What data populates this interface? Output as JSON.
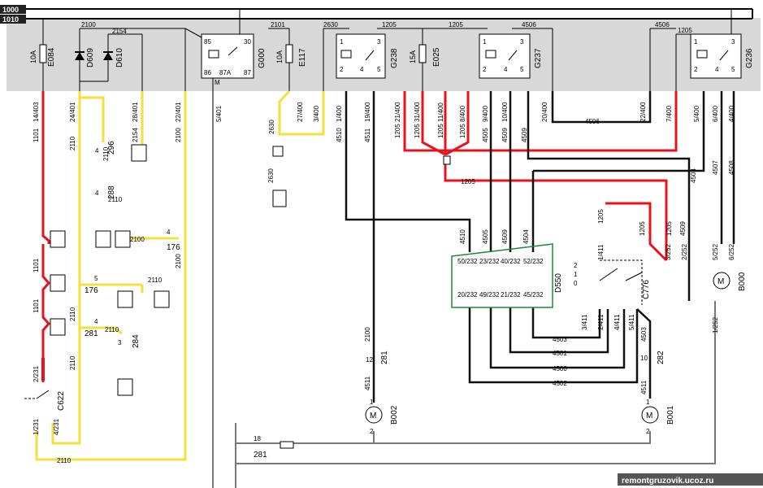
{
  "buses": {
    "top": "1000",
    "second": "1010"
  },
  "fuses": [
    {
      "amp": "10A",
      "id": "E084"
    },
    {
      "amp": "10A",
      "id": "E117"
    },
    {
      "amp": "15A",
      "id": "E025"
    }
  ],
  "diodes": [
    "D609",
    "D610"
  ],
  "relays": [
    {
      "id": "G000",
      "pins": [
        "85",
        "30",
        "86",
        "87A",
        "87"
      ]
    },
    {
      "id": "G238",
      "pins": [
        "1",
        "3",
        "2",
        "4",
        "5"
      ]
    },
    {
      "id": "G237",
      "pins": [
        "1",
        "3",
        "2",
        "4",
        "5"
      ]
    },
    {
      "id": "G236",
      "pins": [
        "1",
        "3",
        "2",
        "4",
        "5"
      ]
    }
  ],
  "ground_mark": "M",
  "top_wires": [
    "2100",
    "2154",
    "2101",
    "2630",
    "1205",
    "1205",
    "4506",
    "4506",
    "1205"
  ],
  "connector_pins": [
    "14/403",
    "24/401",
    "28/401",
    "22/401",
    "5/401",
    "27/400",
    "3/400",
    "1/400",
    "19/400",
    "21/400",
    "31/400",
    "11/400",
    "8/400",
    "9/400",
    "10/400",
    "20/400",
    "22/400",
    "7/400",
    "5/400",
    "6/400",
    "4/400"
  ],
  "wire_numbers": [
    "1101",
    "2110",
    "2154",
    "2100",
    "2630",
    "2630",
    "4510",
    "4511",
    "1205",
    "1205",
    "1205",
    "1205",
    "4505",
    "4509",
    "4509",
    "4506",
    "1205",
    "4504",
    "4507",
    "4508",
    "1205",
    "4510",
    "4505",
    "4509",
    "4504",
    "1205",
    "1205",
    "4509",
    "2110",
    "2110",
    "2100",
    "2100",
    "1101",
    "1101",
    "2110",
    "2110",
    "2110",
    "2110",
    "2110",
    "2100",
    "4511",
    "4511",
    "4503",
    "4503",
    "4501",
    "4500",
    "4502",
    "4503"
  ],
  "small_connectors": [
    "296",
    "288",
    "176",
    "176",
    "281",
    "284",
    "281",
    "282",
    "281"
  ],
  "small_pins": [
    "4",
    "4",
    "4",
    "5",
    "4",
    "3",
    "12",
    "10",
    "18",
    "1",
    "2",
    "1",
    "2"
  ],
  "ecu": {
    "id": "D550",
    "top_pins": [
      "50/232",
      "23/232",
      "40/232",
      "52/232"
    ],
    "bottom_pins": [
      "20/232",
      "49/232",
      "21/232",
      "45/232"
    ]
  },
  "switches": [
    {
      "id": "C622",
      "pins": [
        "2/231",
        "1/231",
        "4/231"
      ]
    },
    {
      "id": "C776",
      "positions": [
        "2",
        "1",
        "0"
      ],
      "pins": [
        "1/411",
        "3/411",
        "2/411",
        "4/411",
        "5/411"
      ]
    }
  ],
  "motors": [
    {
      "id": "B002",
      "symbol": "M"
    },
    {
      "id": "B001",
      "symbol": "M"
    },
    {
      "id": "B000",
      "symbol": "M"
    }
  ],
  "b000_pins": [
    "3/252",
    "2/252",
    "5/252",
    "6/252",
    "1/252"
  ],
  "watermark": "remontgruzovik.ucoz.ru",
  "colors": {
    "panel": "#d8d8d8",
    "red": "#e8121d",
    "yellow": "#f2e13a",
    "black": "#111111",
    "ecu": "#1a8a3a",
    "gray": "#9a9a9a"
  }
}
